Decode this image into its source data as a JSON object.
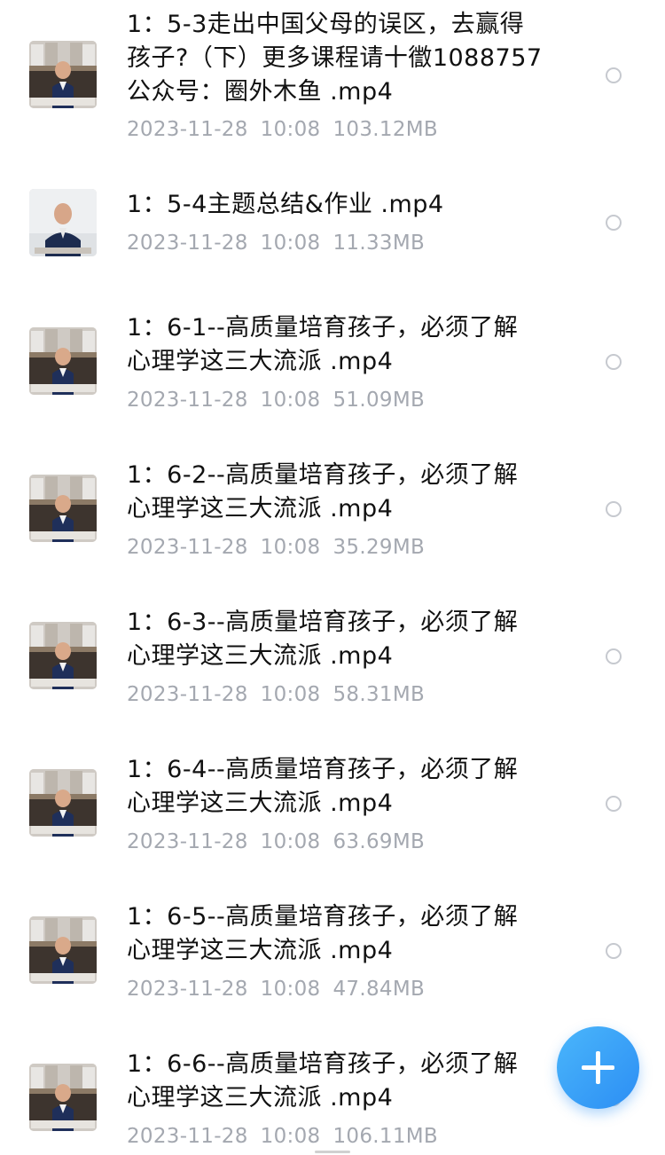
{
  "files": [
    {
      "title_lines": [
        "1：5-3走出中国父母的误区，去赢得",
        "孩子?（下）更多课程请十徾1088757",
        "公众号：圈外木鱼 .mp4"
      ],
      "date": "2023-11-28",
      "time": "10:08",
      "size": "103.12MB",
      "thumbnail": "video-thumbnail-presenter-bookshelf",
      "selected": false
    },
    {
      "title_lines": [
        "1：5-4主题总结&作业 .mp4"
      ],
      "date": "2023-11-28",
      "time": "10:08",
      "size": "11.33MB",
      "thumbnail": "video-thumbnail-presenter-white",
      "selected": false
    },
    {
      "title_lines": [
        "1：6-1--高质量培育孩子，必须了解",
        "心理学这三大流派 .mp4"
      ],
      "date": "2023-11-28",
      "time": "10:08",
      "size": "51.09MB",
      "thumbnail": "video-thumbnail-presenter-bookshelf",
      "selected": false
    },
    {
      "title_lines": [
        "1：6-2--高质量培育孩子，必须了解",
        "心理学这三大流派 .mp4"
      ],
      "date": "2023-11-28",
      "time": "10:08",
      "size": "35.29MB",
      "thumbnail": "video-thumbnail-presenter-bookshelf",
      "selected": false
    },
    {
      "title_lines": [
        "1：6-3--高质量培育孩子，必须了解",
        "心理学这三大流派 .mp4"
      ],
      "date": "2023-11-28",
      "time": "10:08",
      "size": "58.31MB",
      "thumbnail": "video-thumbnail-presenter-bookshelf",
      "selected": false
    },
    {
      "title_lines": [
        "1：6-4--高质量培育孩子，必须了解",
        "心理学这三大流派 .mp4"
      ],
      "date": "2023-11-28",
      "time": "10:08",
      "size": "63.69MB",
      "thumbnail": "video-thumbnail-presenter-bookshelf",
      "selected": false
    },
    {
      "title_lines": [
        "1：6-5--高质量培育孩子，必须了解",
        "心理学这三大流派 .mp4"
      ],
      "date": "2023-11-28",
      "time": "10:08",
      "size": "47.84MB",
      "thumbnail": "video-thumbnail-presenter-bookshelf",
      "selected": false
    },
    {
      "title_lines": [
        "1：6-6--高质量培育孩子，必须了解",
        "心理学这三大流派 .mp4"
      ],
      "date": "2023-11-28",
      "time": "10:08",
      "size": "106.11MB",
      "thumbnail": "video-thumbnail-presenter-bookshelf",
      "selected": false
    }
  ],
  "fab": {
    "icon": "plus-icon",
    "color": "#3a9ef7"
  },
  "colors": {
    "title": "#111111",
    "meta": "#a4a8b0",
    "radio_border": "#c6c9cf"
  }
}
